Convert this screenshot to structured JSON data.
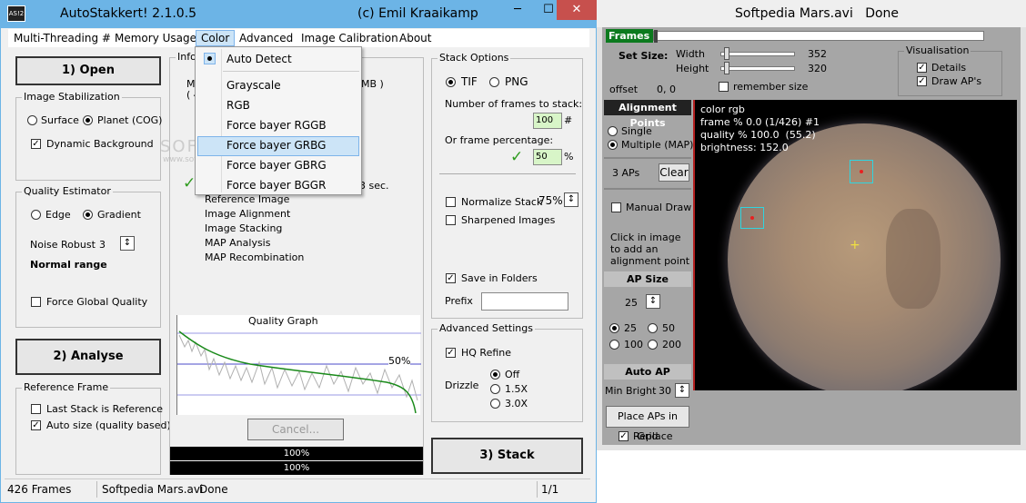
{
  "left_window": {
    "title": "AutoStakkert! 2.1.0.5",
    "author": "(c) Emil Kraaikamp",
    "logo": "AS!2",
    "controls": {
      "min": "─",
      "max": "☐",
      "close": "✕"
    },
    "menu": [
      "Multi-Threading #",
      "Memory Usage",
      "Color",
      "Advanced",
      "Image Calibration",
      "About"
    ],
    "open_button": "1) Open",
    "analyse_button": "2) Analyse",
    "stack_button": "3) Stack",
    "cancel_button": "Cancel...",
    "stabilization": {
      "title": "Image Stabilization",
      "surface": "Surface",
      "planet": "Planet (COG)",
      "dynamic_bg": "Dynamic Background"
    },
    "quality": {
      "title": "Quality Estimator",
      "edge": "Edge",
      "gradient": "Gradient",
      "noise_label": "Noise Robust",
      "noise_value": "3",
      "range": "Normal range",
      "force_global": "Force Global Quality"
    },
    "reference": {
      "title": "Reference Frame",
      "last_stack": "Last Stack is Reference",
      "auto_size": "Auto size (quality based)"
    },
    "info": {
      "title": "Infor",
      "m_line": "M",
      "four_line": "( 4",
      "mb": "MB )",
      "sec": "3 sec.",
      "steps": [
        "Reference Image",
        "Image Alignment",
        "Image Stacking",
        "MAP Analysis",
        "MAP Recombination"
      ]
    },
    "graph": {
      "title": "Quality Graph",
      "pct": "50%"
    },
    "progress": [
      "100%",
      "100%"
    ],
    "stack_options": {
      "title": "Stack Options",
      "tif": "TIF",
      "png": "PNG",
      "frames_label": "Number of frames to stack:",
      "frames_value": "100",
      "frames_unit": "#",
      "pct_label": "Or frame percentage:",
      "pct_value": "50",
      "pct_unit": "%",
      "normalize": "Normalize Stack",
      "normalize_value": "75%",
      "sharpened": "Sharpened Images",
      "save_folders": "Save in Folders",
      "prefix": "Prefix"
    },
    "advanced": {
      "title": "Advanced Settings",
      "hq": "HQ Refine",
      "drizzle": "Drizzle",
      "off": "Off",
      "d15": "1.5X",
      "d30": "3.0X"
    },
    "color_menu": [
      "Auto Detect",
      "Grayscale",
      "RGB",
      "Force bayer RGGB",
      "Force bayer GRBG",
      "Force bayer GBRG",
      "Force bayer BGGR"
    ],
    "status": {
      "frames": "426 Frames",
      "file": "Softpedia Mars.avi",
      "state": "Done",
      "page": "1/1"
    },
    "watermark": "SOFTPEDIA",
    "watermark_url": "www.softpedia.com"
  },
  "right_window": {
    "title": "Softpedia Mars.avi   Done",
    "frames_label": "Frames",
    "set_size": "Set Size:",
    "width_label": "Width",
    "width_value": "352",
    "height_label": "Height",
    "height_value": "320",
    "offset_label": "offset",
    "offset_value": "0, 0",
    "remember": "remember size",
    "vis": {
      "title": "Visualisation",
      "details": "Details",
      "draw": "Draw AP's"
    },
    "ap": {
      "title": "Alignment Points",
      "single": "Single",
      "multiple": "Multiple (MAP)",
      "count": "3 APs",
      "clear": "Clear",
      "manual": "Manual Draw",
      "hint": [
        "Click in image",
        "to add an",
        "alignment point"
      ],
      "size_title": "AP Size",
      "size_value": "25",
      "s25": "25",
      "s50": "50",
      "s100": "100",
      "s200": "200",
      "auto_title": "Auto AP",
      "min_bright": "Min Bright",
      "min_value": "30",
      "place": "Place APs in Grid",
      "replace": "Replace"
    },
    "overlay": [
      "color rgb",
      "frame % 0.0 (1/426) #1",
      "quality % 100.0  (55.2)",
      "brightness: 152.0"
    ]
  }
}
